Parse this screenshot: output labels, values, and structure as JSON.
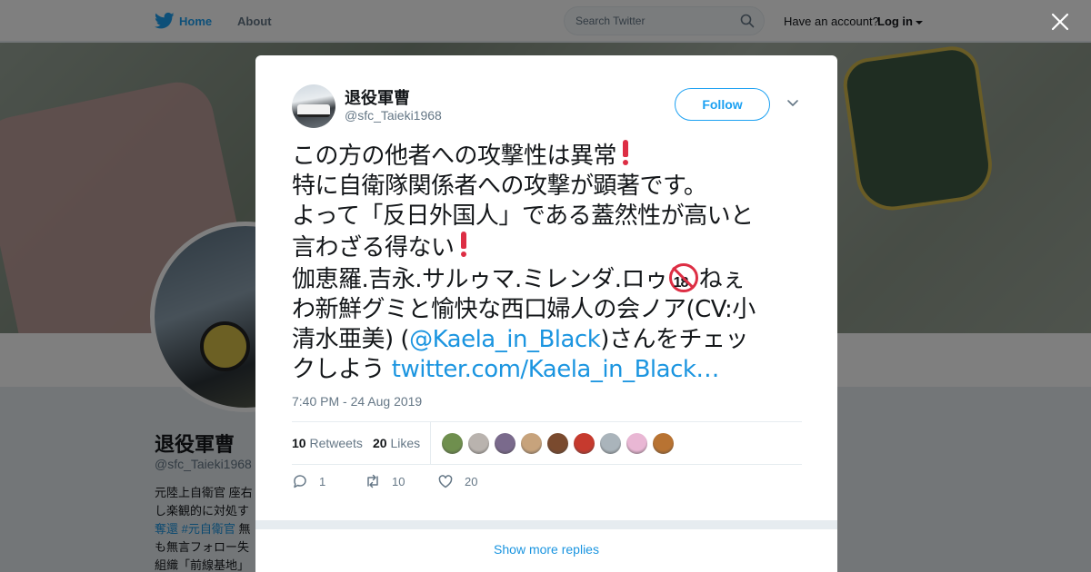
{
  "nav": {
    "home_label": "Home",
    "about_label": "About",
    "search_placeholder": "Search Twitter",
    "have_account": "Have an account?",
    "login_label": "Log in"
  },
  "profile": {
    "name": "退役軍曹",
    "handle": "@sfc_Taieki1968",
    "bio_line1": "元陸上自衛官 座右",
    "bio_line2": "し楽観的に対処す",
    "bio_tag1": "奪還",
    "bio_tag2": "#元自衛官",
    "bio_line3_rest": "無",
    "bio_line4": "も無言フォロー失",
    "bio_line5": "組織「前線基地」"
  },
  "tweet": {
    "display_name": "退役軍曹",
    "screen_name": "@sfc_Taieki1968",
    "follow_label": "Follow",
    "line1": "この方の他者への攻撃性は異常",
    "line2": "特に自衛隊関係者への攻撃が顕著です。",
    "line3": "よって「反日外国人」である蓋然性が高いと",
    "line4": "言わざる得ない",
    "line5": "伽恵羅.吉永.サルゥマ.ミレンダ.ロゥ",
    "badge": "18",
    "line5_end": "ねぇ",
    "line6": "わ新鮮グミと愉快な西口婦人の会ノア(CV:小",
    "line7_pre": "清水亜美) (",
    "mention": "@Kaela_in_Black",
    "line7_post": ")さんをチェッ",
    "line8_pre": "クしよう ",
    "link": "twitter.com/Kaela_in_Black…",
    "timestamp": "7:40 PM - 24 Aug 2019"
  },
  "stats": {
    "retweets_count": "10",
    "retweets_label": "Retweets",
    "likes_count": "20",
    "likes_label": "Likes",
    "liker_colors": [
      "#6f8f4e",
      "#b9b3ae",
      "#7a6a8c",
      "#c7a37c",
      "#7a4a2e",
      "#c63a2e",
      "#aab4bb",
      "#e9b7d4",
      "#b87332"
    ]
  },
  "actions": {
    "replies": "1",
    "retweets": "10",
    "likes": "20"
  },
  "show_more": "Show more replies"
}
